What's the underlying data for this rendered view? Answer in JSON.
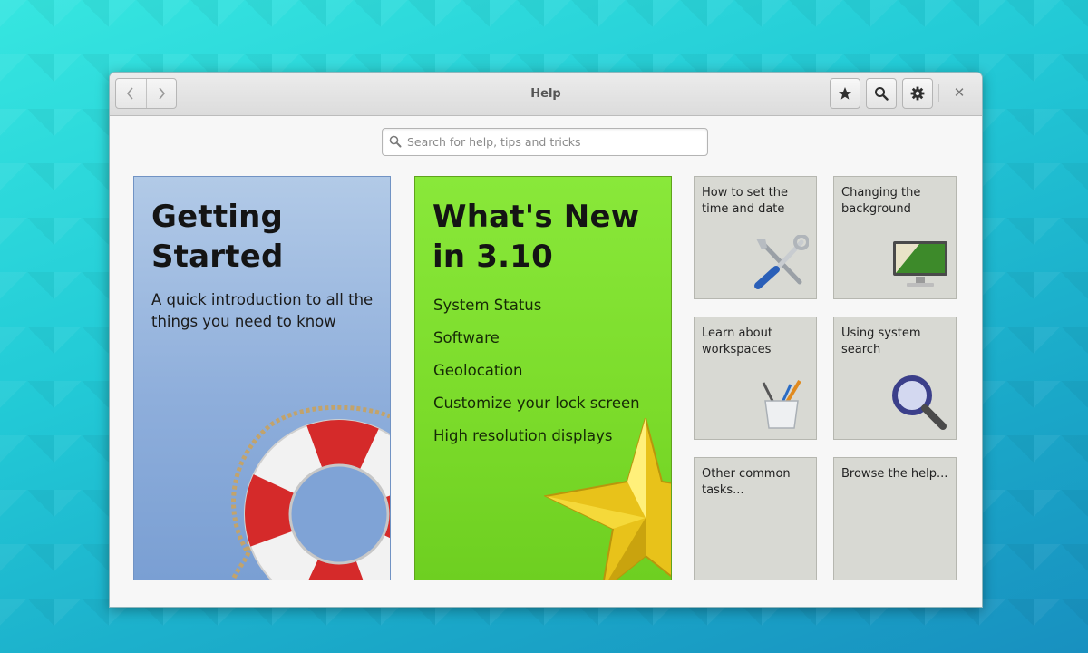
{
  "window": {
    "title": "Help"
  },
  "toolbar": {
    "back_icon": "chevron-left-icon",
    "forward_icon": "chevron-right-icon",
    "bookmarks_icon": "star-icon",
    "search_icon": "search-icon",
    "menu_icon": "gear-icon",
    "close_glyph": "✕"
  },
  "search": {
    "placeholder": "Search for help, tips and tricks",
    "value": ""
  },
  "cards": {
    "getting_started": {
      "title_line1": "Getting",
      "title_line2": "Started",
      "subtitle": "A quick introduction to all the things you need to know",
      "color": "#8eaedb"
    },
    "whats_new": {
      "title_line1": "What's New",
      "title_line2": "in 3.10",
      "items": [
        "System Status",
        "Software",
        "Geolocation",
        "Customize your lock screen",
        "High resolution displays"
      ],
      "color": "#7bdb2a"
    }
  },
  "tiles": [
    {
      "label": "How to set the time and date",
      "icon": "tools-icon"
    },
    {
      "label": "Changing the background",
      "icon": "monitor-icon"
    },
    {
      "label": "Learn about workspaces",
      "icon": "brushes-cup-icon"
    },
    {
      "label": "Using system search",
      "icon": "magnifier-icon"
    },
    {
      "label": "Other common tasks...",
      "icon": ""
    },
    {
      "label": "Browse the help...",
      "icon": ""
    }
  ]
}
